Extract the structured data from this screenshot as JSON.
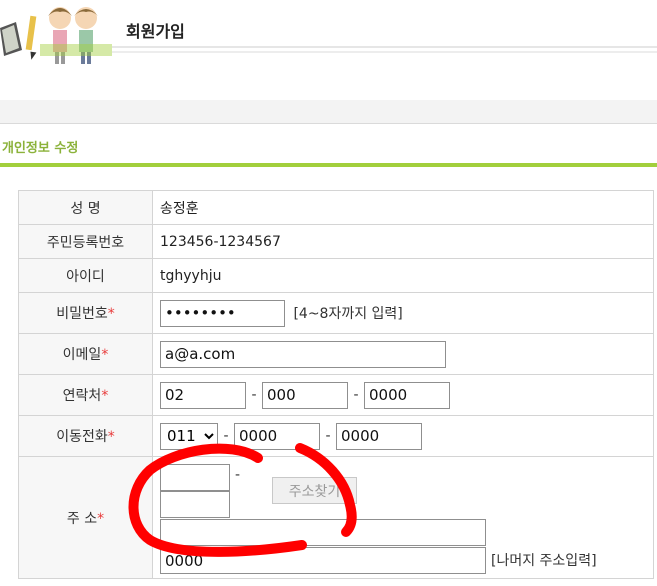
{
  "header": {
    "title": "회원가입"
  },
  "section": {
    "title": "개인정보 수정"
  },
  "colors": {
    "accent_green": "#a2cf3c",
    "section_title": "#8bb23a",
    "required": "#e83b3b",
    "annotation_red": "#ff0000"
  },
  "form": {
    "name": {
      "label": "성 명",
      "value": "송정훈"
    },
    "rrn": {
      "label": "주민등록번호",
      "value": "123456-1234567"
    },
    "userid": {
      "label": "아이디",
      "value": "tghyyhju"
    },
    "password": {
      "label": "비밀번호",
      "required": "*",
      "value": "••••••••",
      "hint": "[4~8자까지 입력]"
    },
    "email": {
      "label": "이메일",
      "required": "*",
      "value": "a@a.com"
    },
    "phone": {
      "label": "연락처",
      "required": "*",
      "part1": "02",
      "part2": "000",
      "part3": "0000",
      "sep": "-"
    },
    "mobile": {
      "label": "이동전화",
      "required": "*",
      "carrier": "011",
      "part2": "0000",
      "part3": "0000",
      "sep": "-"
    },
    "address": {
      "label": "주 소",
      "required": "*",
      "zip1": "",
      "zip2": "",
      "zip_sep": "-",
      "search_button": "주소찾기",
      "addr1": "",
      "addr2": "0000",
      "hint": "[나머지 주소입력]"
    }
  },
  "icons": {
    "logo": "children-with-book-logo"
  }
}
